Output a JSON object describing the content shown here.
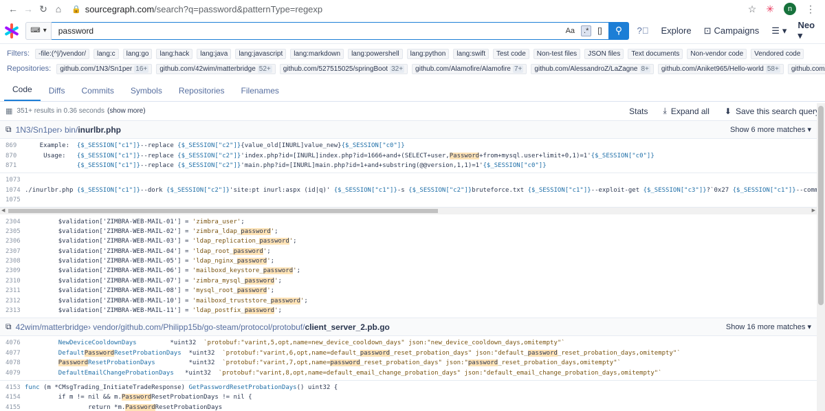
{
  "browser": {
    "url_host": "sourcegraph.com",
    "url_path": "/search?q=password&patternType=regexp",
    "avatar_letter": "n"
  },
  "header": {
    "query": "password",
    "case_toggle": "Aa",
    "regex_toggle": ".*",
    "structural_toggle": "[]",
    "explore": "Explore",
    "campaigns": "Campaigns",
    "user": "Neo"
  },
  "filters": {
    "label": "Filters:",
    "items": [
      "-file:(^|/)vendor/",
      "lang:c",
      "lang:go",
      "lang:hack",
      "lang:java",
      "lang:javascript",
      "lang:markdown",
      "lang:powershell",
      "lang:python",
      "lang:swift",
      "Test code",
      "Non-test files",
      "JSON files",
      "Text documents",
      "Non-vendor code",
      "Vendored code"
    ]
  },
  "repositories": {
    "label": "Repositories:",
    "items": [
      {
        "name": "github.com/1N3/Sn1per",
        "count": "16+"
      },
      {
        "name": "github.com/42wim/matterbridge",
        "count": "52+"
      },
      {
        "name": "github.com/527515025/springBoot",
        "count": "32+"
      },
      {
        "name": "github.com/Alamofire/Alamofire",
        "count": "7+"
      },
      {
        "name": "github.com/AlessandroZ/LaZagne",
        "count": "8+"
      },
      {
        "name": "github.com/Aniket965/Hello-world",
        "count": "58+"
      },
      {
        "name": "github.com/AnomalyInnovations/serverless-stack-com",
        "count": ""
      }
    ]
  },
  "tabs": [
    "Code",
    "Diffs",
    "Commits",
    "Symbols",
    "Repositories",
    "Filenames"
  ],
  "stats": {
    "results": "351+ results in 0.36 seconds",
    "show_more": "(show more)",
    "stats_label": "Stats",
    "expand_all": "Expand all",
    "save_query": "Save this search query"
  },
  "results": [
    {
      "repo": "1N3/Sn1per",
      "sep": " › bin/",
      "file": "inurlbr.php",
      "show_more": "Show 6 more matches",
      "blocks": [
        [
          {
            "n": "869",
            "segs": [
              [
                "t",
                "    Example:  "
              ],
              [
                "b",
                "{$_SESSION[\"c1\"]}"
              ],
              [
                "t",
                "--replace "
              ],
              [
                "b",
                "{$_SESSION[\"c2\"]}"
              ],
              [
                "t",
                "{value_old[INURL]value_new}"
              ],
              [
                "b",
                "{$_SESSION[\"c0\"]}"
              ]
            ]
          },
          {
            "n": "870",
            "segs": [
              [
                "t",
                "     Usage:   "
              ],
              [
                "b",
                "{$_SESSION[\"c1\"]}"
              ],
              [
                "t",
                "--replace "
              ],
              [
                "b",
                "{$_SESSION[\"c2\"]}"
              ],
              [
                "t",
                "'index.php?id=[INURL]index.php?id=1666+and+(SELECT+user,"
              ],
              [
                "h",
                "Password"
              ],
              [
                "t",
                "+from+mysql.user+limit+0,1)=1'"
              ],
              [
                "b",
                "{$_SESSION[\"c0\"]}"
              ]
            ]
          },
          {
            "n": "871",
            "segs": [
              [
                "t",
                "              "
              ],
              [
                "b",
                "{$_SESSION[\"c1\"]}"
              ],
              [
                "t",
                "--replace "
              ],
              [
                "b",
                "{$_SESSION[\"c2\"]}"
              ],
              [
                "t",
                "'main.php?id=[INURL]main.php?id=1+and+substring(@@version,1,1)=1'"
              ],
              [
                "b",
                "{$_SESSION[\"c0\"]}"
              ]
            ]
          }
        ],
        [
          {
            "n": "1073",
            "segs": [
              [
                "t",
                ""
              ]
            ]
          },
          {
            "n": "1074",
            "segs": [
              [
                "t",
                "./inurlbr.php "
              ],
              [
                "b",
                "{$_SESSION[\"c1\"]}"
              ],
              [
                "t",
                "--dork "
              ],
              [
                "b",
                "{$_SESSION[\"c2\"]}"
              ],
              [
                "t",
                "'site:pt inurl:aspx (id|q)' "
              ],
              [
                "b",
                "{$_SESSION[\"c1\"]}"
              ],
              [
                "t",
                "-s "
              ],
              [
                "b",
                "{$_SESSION[\"c2\"]}"
              ],
              [
                "t",
                "bruteforce.txt "
              ],
              [
                "b",
                "{$_SESSION[\"c1\"]}"
              ],
              [
                "t",
                "--exploit-get "
              ],
              [
                "b",
                "{$_SESSION[\"c3\"]}"
              ],
              [
                "t",
                "?`0x27 "
              ],
              [
                "b",
                "{$_SESSION[\"c1\"]}"
              ],
              [
                "t",
                "--command-vul {$"
              ]
            ]
          },
          {
            "n": "1075",
            "segs": [
              [
                "t",
                ""
              ]
            ]
          }
        ],
        [
          {
            "n": "2304",
            "segs": [
              [
                "t",
                "         $validation['ZIMBRA-WEB-MAIL-01'] = "
              ],
              [
                "s",
                "'zimbra_user'"
              ],
              [
                "t",
                ";"
              ]
            ]
          },
          {
            "n": "2305",
            "segs": [
              [
                "t",
                "         $validation['ZIMBRA-WEB-MAIL-02'] = "
              ],
              [
                "s",
                "'zimbra_ldap_"
              ],
              [
                "h",
                "password"
              ],
              [
                "s",
                "'"
              ],
              [
                "t",
                ";"
              ]
            ]
          },
          {
            "n": "2306",
            "segs": [
              [
                "t",
                "         $validation['ZIMBRA-WEB-MAIL-03'] = "
              ],
              [
                "s",
                "'ldap_replication_"
              ],
              [
                "h",
                "password"
              ],
              [
                "s",
                "'"
              ],
              [
                "t",
                ";"
              ]
            ]
          },
          {
            "n": "2307",
            "segs": [
              [
                "t",
                "         $validation['ZIMBRA-WEB-MAIL-04'] = "
              ],
              [
                "s",
                "'ldap_root_"
              ],
              [
                "h",
                "password"
              ],
              [
                "s",
                "'"
              ],
              [
                "t",
                ";"
              ]
            ]
          },
          {
            "n": "2308",
            "segs": [
              [
                "t",
                "         $validation['ZIMBRA-WEB-MAIL-05'] = "
              ],
              [
                "s",
                "'ldap_nginx_"
              ],
              [
                "h",
                "password"
              ],
              [
                "s",
                "'"
              ],
              [
                "t",
                ";"
              ]
            ]
          },
          {
            "n": "2309",
            "segs": [
              [
                "t",
                "         $validation['ZIMBRA-WEB-MAIL-06'] = "
              ],
              [
                "s",
                "'mailboxd_keystore_"
              ],
              [
                "h",
                "password"
              ],
              [
                "s",
                "'"
              ],
              [
                "t",
                ";"
              ]
            ]
          },
          {
            "n": "2310",
            "segs": [
              [
                "t",
                "         $validation['ZIMBRA-WEB-MAIL-07'] = "
              ],
              [
                "s",
                "'zimbra_mysql_"
              ],
              [
                "h",
                "password"
              ],
              [
                "s",
                "'"
              ],
              [
                "t",
                ";"
              ]
            ]
          },
          {
            "n": "2311",
            "segs": [
              [
                "t",
                "         $validation['ZIMBRA-WEB-MAIL-08'] = "
              ],
              [
                "s",
                "'mysql_root_"
              ],
              [
                "h",
                "password"
              ],
              [
                "s",
                "'"
              ],
              [
                "t",
                ";"
              ]
            ]
          },
          {
            "n": "2312",
            "segs": [
              [
                "t",
                "         $validation['ZIMBRA-WEB-MAIL-10'] = "
              ],
              [
                "s",
                "'mailboxd_truststore_"
              ],
              [
                "h",
                "password"
              ],
              [
                "s",
                "'"
              ],
              [
                "t",
                ";"
              ]
            ]
          },
          {
            "n": "2313",
            "segs": [
              [
                "t",
                "         $validation['ZIMBRA-WEB-MAIL-11'] = "
              ],
              [
                "s",
                "'ldap_postfix_"
              ],
              [
                "h",
                "password"
              ],
              [
                "s",
                "'"
              ],
              [
                "t",
                ";"
              ]
            ]
          }
        ]
      ]
    },
    {
      "repo": "42wim/matterbridge",
      "sep": " › vendor/github.com/Philipp15b/go-steam/protocol/protobuf/",
      "file": "client_server_2.pb.go",
      "show_more": "Show 16 more matches",
      "blocks": [
        [
          {
            "n": "4076",
            "segs": [
              [
                "t",
                "         "
              ],
              [
                "b",
                "NewDeviceCooldownDays"
              ],
              [
                "t",
                "         *uint32  "
              ],
              [
                "s",
                "`protobuf:\"varint,5,opt,name=new_device_cooldown_days\" json:\"new_device_cooldown_days,omitempty\"`"
              ]
            ]
          },
          {
            "n": "4077",
            "segs": [
              [
                "t",
                "         "
              ],
              [
                "b",
                "Default"
              ],
              [
                "h",
                "Password"
              ],
              [
                "b",
                "ResetProbationDays"
              ],
              [
                "t",
                "  *uint32  "
              ],
              [
                "s",
                "`protobuf:\"varint,6,opt,name=default_"
              ],
              [
                "h",
                "password"
              ],
              [
                "s",
                "_reset_probation_days\" json:\"default_"
              ],
              [
                "h",
                "password"
              ],
              [
                "s",
                "_reset_probation_days,omitempty\"`"
              ]
            ]
          },
          {
            "n": "4078",
            "segs": [
              [
                "t",
                "         "
              ],
              [
                "h",
                "Password"
              ],
              [
                "b",
                "ResetProbationDays"
              ],
              [
                "t",
                "         *uint32  "
              ],
              [
                "s",
                "`protobuf:\"varint,7,opt,name="
              ],
              [
                "h",
                "password"
              ],
              [
                "s",
                "_reset_probation_days\" json:\""
              ],
              [
                "h",
                "password"
              ],
              [
                "s",
                "_reset_probation_days,omitempty\"`"
              ]
            ]
          },
          {
            "n": "4079",
            "segs": [
              [
                "t",
                "         "
              ],
              [
                "b",
                "DefaultEmailChangeProbationDays"
              ],
              [
                "t",
                "   *uint32  "
              ],
              [
                "s",
                "`protobuf:\"varint,8,opt,name=default_email_change_probation_days\" json:\"default_email_change_probation_days,omitempty\"`"
              ]
            ]
          }
        ],
        [
          {
            "n": "4153",
            "segs": [
              [
                "b",
                "func"
              ],
              [
                "t",
                " (m *CMsgTrading_InitiateTradeResponse) "
              ],
              [
                "b",
                "GetPasswordResetProbationDays"
              ],
              [
                "t",
                "() uint32 {"
              ]
            ]
          },
          {
            "n": "4154",
            "segs": [
              [
                "t",
                "         if m != nil && m."
              ],
              [
                "h",
                "Password"
              ],
              [
                "t",
                "ResetProbationDays != nil {"
              ]
            ]
          },
          {
            "n": "4155",
            "segs": [
              [
                "t",
                "                 return *m."
              ],
              [
                "h",
                "Password"
              ],
              [
                "t",
                "ResetProbationDays"
              ]
            ]
          }
        ]
      ]
    }
  ]
}
